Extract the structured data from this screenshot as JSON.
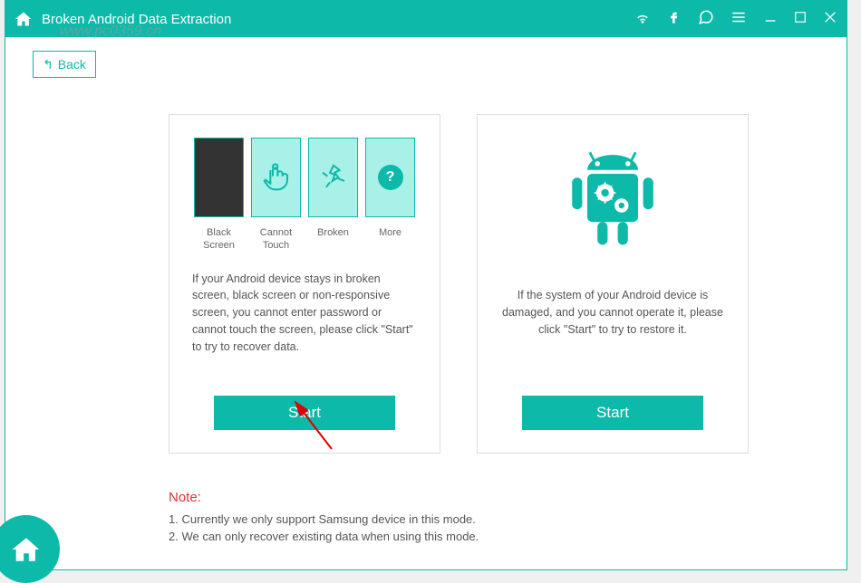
{
  "titlebar": {
    "title": "Broken Android Data Extraction"
  },
  "back": {
    "label": "Back"
  },
  "watermark": "www.pc0359.cn",
  "panel_left": {
    "options": {
      "black_screen": "Black Screen",
      "cannot_touch": "Cannot Touch",
      "broken": "Broken",
      "more": "More"
    },
    "description": "If your Android device stays in broken screen, black screen or non-responsive screen, you cannot enter password or cannot touch the screen, please click \"Start\" to try to recover data.",
    "start_label": "Start"
  },
  "panel_right": {
    "description": "If the system of your Android device is damaged, and you cannot operate it, please click \"Start\" to try to restore it.",
    "start_label": "Start"
  },
  "notes": {
    "title": "Note:",
    "item1": "1. Currently we only support Samsung device in this mode.",
    "item2": "2. We can only recover existing data when using this mode."
  }
}
